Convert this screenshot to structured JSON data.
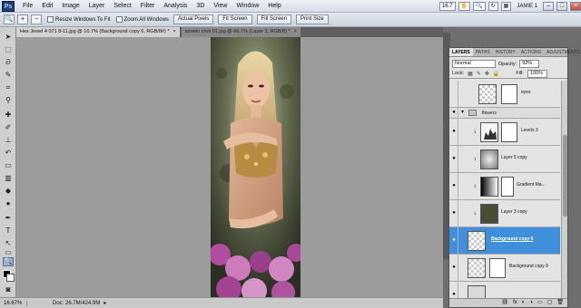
{
  "app": {
    "logo": "Ps",
    "menu": [
      "File",
      "Edit",
      "Image",
      "Layer",
      "Select",
      "Filter",
      "Analysis",
      "3D",
      "View",
      "Window",
      "Help"
    ],
    "zoom_box": "16.7",
    "workspace": "JAMIE 1"
  },
  "options": {
    "resize_windows": "Resize Windows To Fit",
    "zoom_all": "Zoom All Windows",
    "actual_pixels": "Actual Pixels",
    "fit_screen": "Fit Screen",
    "fill_screen": "Fill Screen",
    "print_size": "Print Size"
  },
  "tabs": [
    {
      "label": "Hex Jewel 4 071 8-11.jpg @ 16.7% (Background copy 6, RGB/8#) *",
      "close": "×"
    },
    {
      "label": "screen shot 01.jpg @ 66.7% (Layer 3, RGB/8) *",
      "close": "×"
    }
  ],
  "status": {
    "zoom": "16.67%",
    "doc": "Doc: 26.7M/424.9M",
    "arrow": "▸"
  },
  "layers_panel": {
    "tabs": [
      "LAYERS",
      "PATHS",
      "HISTORY",
      "ACTIONS",
      "ADJUSTMENTS"
    ],
    "blend_mode": "Normal",
    "opacity_label": "Opacity:",
    "opacity_value": "92%",
    "lock_label": "Lock:",
    "fill_label": "Fill:",
    "fill_value": "100%",
    "group_name": "flowers",
    "layers": [
      {
        "name": "eyes",
        "visible": false
      },
      {
        "name": "Levels 3",
        "visible": true
      },
      {
        "name": "Layer 5 copy",
        "visible": true
      },
      {
        "name": "Gradient Ma...",
        "visible": true
      },
      {
        "name": "Layer 3 copy",
        "visible": true
      },
      {
        "name": "Background copy 6",
        "visible": true,
        "selected": true
      },
      {
        "name": "Background copy 9",
        "visible": true
      }
    ]
  },
  "colors": {
    "selection": "#3f8fdd",
    "canvas_bg": "#9c9c9c"
  }
}
